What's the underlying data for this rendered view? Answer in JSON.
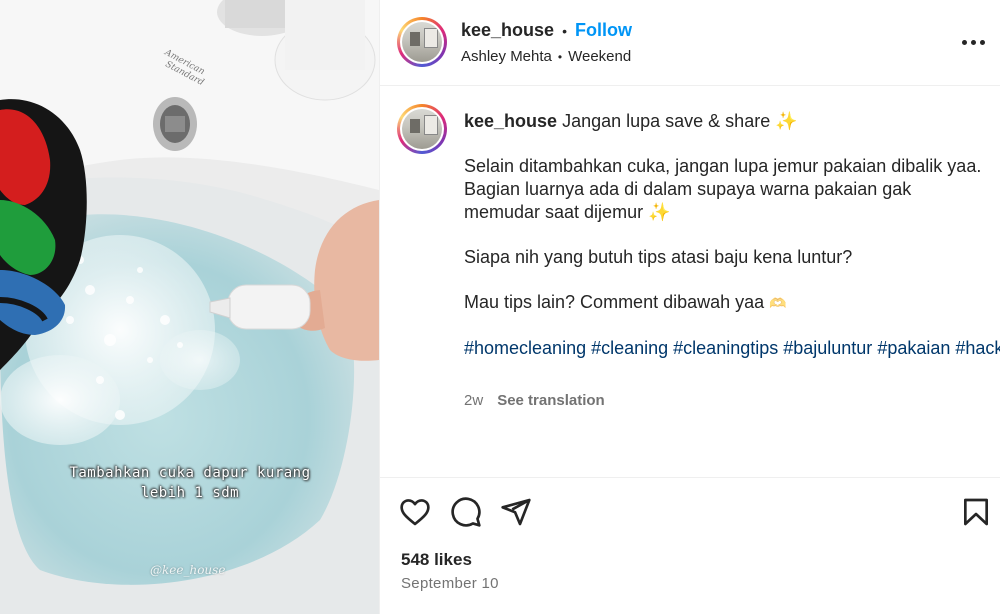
{
  "post": {
    "username": "kee_house",
    "follow_label": "Follow",
    "subtitle_author": "Ashley Mehta",
    "subtitle_audio": "Weekend",
    "more_icon": "more-horizontal-icon"
  },
  "media": {
    "overlay_line1": "Tambahkan cuka dapur kurang",
    "overlay_line2": "lebih 1 sdm",
    "watermark": "@kee_house",
    "sink_brand_line1": "American",
    "sink_brand_line2": "Standard"
  },
  "caption": {
    "username": "kee_house",
    "line1": "Jangan lupa save & share",
    "para2": "Selain ditambahkan cuka, jangan lupa jemur pakaian dibalik yaa. Bagian luarnya ada di dalam supaya warna pakaian gak memudar saat dijemur",
    "para3": "Siapa nih yang butuh tips atasi baju kena luntur?",
    "para4": "Mau tips lain? Comment dibawah yaa",
    "sparkle_emoji": "✨",
    "hands_emoji": "🫶",
    "hashtags": [
      "#homecleaning",
      "#cleaning",
      "#cleaningtips",
      "#bajuluntur",
      "#pakaian",
      "#hacks"
    ],
    "age": "2w",
    "see_translation": "See translation"
  },
  "actions": {
    "like_icon": "heart-icon",
    "comment_icon": "comment-icon",
    "share_icon": "send-icon",
    "save_icon": "bookmark-icon",
    "likes_text": "548 likes",
    "date_text": "September 10"
  },
  "colors": {
    "follow_blue": "#0095f6",
    "hashtag_blue": "#00376b",
    "muted_gray": "#737373",
    "text_dark": "#262626"
  }
}
